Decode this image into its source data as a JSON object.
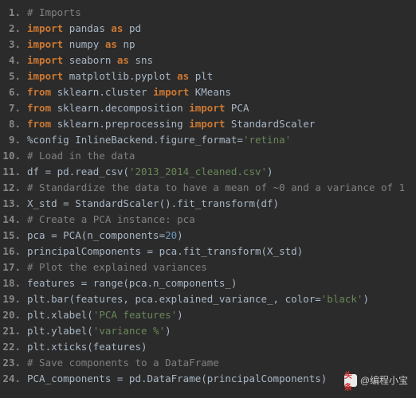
{
  "lines": [
    {
      "n": "1.",
      "tokens": [
        [
          "comment",
          "# Imports"
        ]
      ]
    },
    {
      "n": "2.",
      "tokens": [
        [
          "keyword",
          "import"
        ],
        [
          "op",
          " "
        ],
        [
          "ident",
          "pandas"
        ],
        [
          "op",
          " "
        ],
        [
          "keyword",
          "as"
        ],
        [
          "op",
          " "
        ],
        [
          "ident",
          "pd"
        ]
      ]
    },
    {
      "n": "3.",
      "tokens": [
        [
          "keyword",
          "import"
        ],
        [
          "op",
          " "
        ],
        [
          "ident",
          "numpy"
        ],
        [
          "op",
          " "
        ],
        [
          "keyword",
          "as"
        ],
        [
          "op",
          " "
        ],
        [
          "ident",
          "np"
        ]
      ]
    },
    {
      "n": "4.",
      "tokens": [
        [
          "keyword",
          "import"
        ],
        [
          "op",
          " "
        ],
        [
          "ident",
          "seaborn"
        ],
        [
          "op",
          " "
        ],
        [
          "keyword",
          "as"
        ],
        [
          "op",
          " "
        ],
        [
          "ident",
          "sns"
        ]
      ]
    },
    {
      "n": "5.",
      "tokens": [
        [
          "keyword",
          "import"
        ],
        [
          "op",
          " "
        ],
        [
          "ident",
          "matplotlib.pyplot"
        ],
        [
          "op",
          " "
        ],
        [
          "keyword",
          "as"
        ],
        [
          "op",
          " "
        ],
        [
          "ident",
          "plt"
        ]
      ]
    },
    {
      "n": "6.",
      "tokens": [
        [
          "keyword",
          "from"
        ],
        [
          "op",
          " "
        ],
        [
          "ident",
          "sklearn.cluster"
        ],
        [
          "op",
          " "
        ],
        [
          "keyword",
          "import"
        ],
        [
          "op",
          " "
        ],
        [
          "ident",
          "KMeans"
        ]
      ]
    },
    {
      "n": "7.",
      "tokens": [
        [
          "keyword",
          "from"
        ],
        [
          "op",
          " "
        ],
        [
          "ident",
          "sklearn.decomposition"
        ],
        [
          "op",
          " "
        ],
        [
          "keyword",
          "import"
        ],
        [
          "op",
          " "
        ],
        [
          "ident",
          "PCA"
        ]
      ]
    },
    {
      "n": "8.",
      "tokens": [
        [
          "keyword",
          "from"
        ],
        [
          "op",
          " "
        ],
        [
          "ident",
          "sklearn.preprocessing"
        ],
        [
          "op",
          " "
        ],
        [
          "keyword",
          "import"
        ],
        [
          "op",
          " "
        ],
        [
          "ident",
          "StandardScaler"
        ]
      ]
    },
    {
      "n": "9.",
      "tokens": [
        [
          "magic",
          "%config"
        ],
        [
          "op",
          " "
        ],
        [
          "ident",
          "InlineBackend.figure_format="
        ],
        [
          "string",
          "'retina'"
        ]
      ]
    },
    {
      "n": "10.",
      "tokens": [
        [
          "comment",
          "# Load in the data"
        ]
      ]
    },
    {
      "n": "11.",
      "tokens": [
        [
          "ident",
          "df = pd.read_csv("
        ],
        [
          "string",
          "'2013_2014_cleaned.csv'"
        ],
        [
          "ident",
          ")"
        ]
      ]
    },
    {
      "n": "12.",
      "tokens": [
        [
          "comment",
          "# Standardize the data to have a mean of ~0 and a variance of 1"
        ]
      ]
    },
    {
      "n": "13.",
      "tokens": [
        [
          "ident",
          "X_std = StandardScaler().fit_transform(df)"
        ]
      ]
    },
    {
      "n": "14.",
      "tokens": [
        [
          "comment",
          "# Create a PCA instance: pca"
        ]
      ]
    },
    {
      "n": "15.",
      "tokens": [
        [
          "ident",
          "pca = PCA(n_components="
        ],
        [
          "number",
          "20"
        ],
        [
          "ident",
          ")"
        ]
      ]
    },
    {
      "n": "16.",
      "tokens": [
        [
          "ident",
          "principalComponents = pca.fit_transform(X_std)"
        ]
      ]
    },
    {
      "n": "17.",
      "tokens": [
        [
          "comment",
          "# Plot the explained variances"
        ]
      ]
    },
    {
      "n": "18.",
      "tokens": [
        [
          "ident",
          "features = range(pca.n_components_)"
        ]
      ]
    },
    {
      "n": "19.",
      "tokens": [
        [
          "ident",
          "plt.bar(features, pca.explained_variance_, color="
        ],
        [
          "string",
          "'black'"
        ],
        [
          "ident",
          ")"
        ]
      ]
    },
    {
      "n": "20.",
      "tokens": [
        [
          "ident",
          "plt.xlabel("
        ],
        [
          "string",
          "'PCA features'"
        ],
        [
          "ident",
          ")"
        ]
      ]
    },
    {
      "n": "21.",
      "tokens": [
        [
          "ident",
          "plt.ylabel("
        ],
        [
          "string",
          "'variance %'"
        ],
        [
          "ident",
          ")"
        ]
      ]
    },
    {
      "n": "22.",
      "tokens": [
        [
          "ident",
          "plt.xticks(features)"
        ]
      ]
    },
    {
      "n": "23.",
      "tokens": [
        [
          "comment",
          "# Save components to a DataFrame"
        ]
      ]
    },
    {
      "n": "24.",
      "tokens": [
        [
          "ident",
          "PCA_components = pd.DataFrame(principalComponents)"
        ]
      ]
    }
  ],
  "watermark": {
    "icon_text": "头条",
    "label": "@编程小宝"
  }
}
